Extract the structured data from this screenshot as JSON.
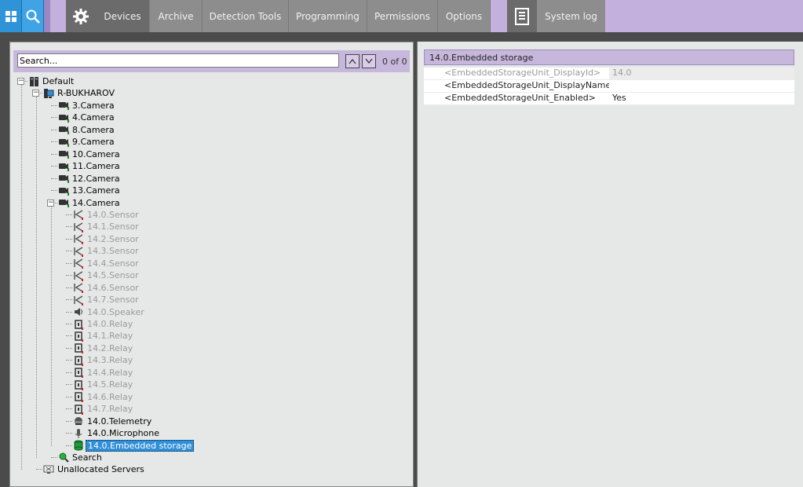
{
  "topbar": {
    "tabs": [
      {
        "label": "Devices",
        "active": true
      },
      {
        "label": "Archive"
      },
      {
        "label": "Detection Tools"
      },
      {
        "label": "Programming"
      },
      {
        "label": "Permissions"
      },
      {
        "label": "Options"
      }
    ],
    "syslog_label": "System log"
  },
  "search": {
    "placeholder": "Search...",
    "value": "Search...",
    "count": "0 of 0"
  },
  "tree": {
    "root": "Default",
    "server": "R-BUKHAROV",
    "cameras": [
      "3.Camera",
      "4.Camera",
      "8.Camera",
      "9.Camera",
      "10.Camera",
      "11.Camera",
      "12.Camera",
      "13.Camera",
      "14.Camera"
    ],
    "sensors": [
      "14.0.Sensor",
      "14.1.Sensor",
      "14.2.Sensor",
      "14.3.Sensor",
      "14.4.Sensor",
      "14.5.Sensor",
      "14.6.Sensor",
      "14.7.Sensor"
    ],
    "speaker": "14.0.Speaker",
    "relays": [
      "14.0.Relay",
      "14.1.Relay",
      "14.2.Relay",
      "14.3.Relay",
      "14.4.Relay",
      "14.5.Relay",
      "14.6.Relay",
      "14.7.Relay"
    ],
    "telemetry": "14.0.Telemetry",
    "microphone": "14.0.Microphone",
    "storage": "14.0.Embedded storage",
    "search": "Search",
    "unallocated": "Unallocated Servers"
  },
  "properties": {
    "title": "14.0.Embedded storage",
    "rows": [
      {
        "key": "<EmbeddedStorageUnit_DisplayId>",
        "value": "14.0"
      },
      {
        "key": "<EmbeddedStorageUnit_DisplayName>",
        "value": ""
      },
      {
        "key": "<EmbeddedStorageUnit_Enabled>",
        "value": "Yes"
      }
    ]
  },
  "colors": {
    "accent_purple": "#c7b7dc",
    "selection_blue": "#2f8fd8",
    "tab_gray": "#8d8d8d"
  }
}
